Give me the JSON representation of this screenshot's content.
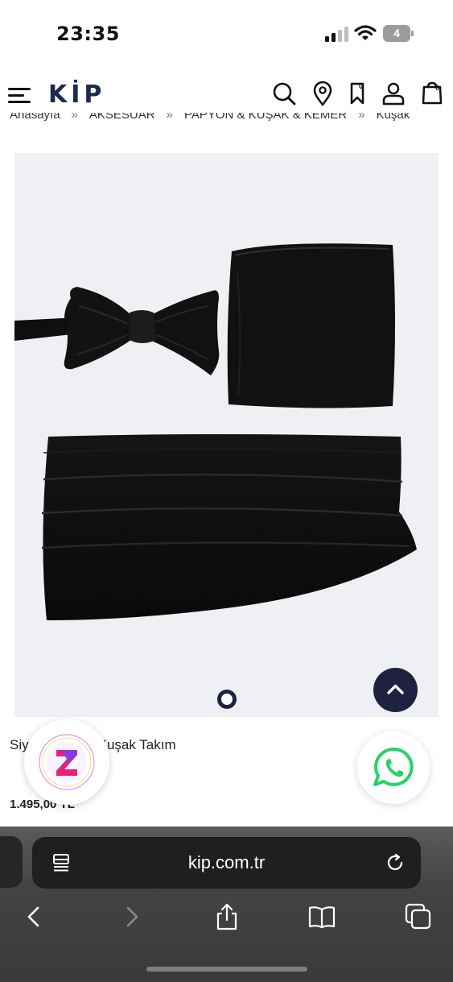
{
  "status_bar": {
    "time": "23:35",
    "battery_level": "4"
  },
  "header": {
    "logo": "KİP",
    "wishlist_count": "0",
    "cart_count": "0",
    "breadcrumb": [
      "Anasayfa",
      "AKSESUAR",
      "PAPYON & KUŞAK & KEMER",
      "Kuşak"
    ]
  },
  "product": {
    "name": "Siyah Papyon Kuşak Takım",
    "price": "1.495,00 TL",
    "image_icon": "product-photo",
    "slide_current": 1,
    "slide_total": 1
  },
  "browser": {
    "address": "kip.com.tr"
  },
  "colors": {
    "brand_navy": "#1b2a4e",
    "button_dark": "#1e2240",
    "whatsapp_green": "#25d366"
  }
}
